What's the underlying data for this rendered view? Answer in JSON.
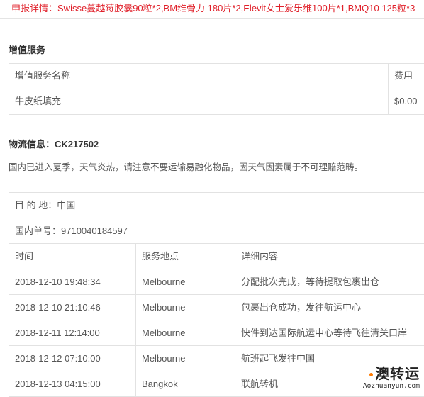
{
  "declaration": {
    "label": "申报详情：",
    "value": "Swisse蔓越莓胶囊90粒*2,BM维骨力 180片*2,Elevit女士爱乐维100片*1,BMQ10 125粒*3"
  },
  "value_added": {
    "title": "增值服务",
    "headers": {
      "name": "增值服务名称",
      "fee": "费用"
    },
    "rows": [
      {
        "name": "牛皮纸填充",
        "fee": "$0.00"
      }
    ]
  },
  "logistics": {
    "title": "物流信息：CK217502",
    "notice": "国内已进入夏季，天气炎热，请注意不要运输易融化物品，因天气因素属于不可理赔范畴。",
    "destination": "目 的 地：中国",
    "tracking": "国内单号：9710040184597",
    "headers": {
      "time": "时间",
      "place": "服务地点",
      "detail": "详细内容"
    },
    "rows": [
      {
        "time": "2018-12-10 19:48:34",
        "place": "Melbourne",
        "detail": "分配批次完成，等待提取包裹出仓"
      },
      {
        "time": "2018-12-10 21:10:46",
        "place": "Melbourne",
        "detail": "包裹出仓成功，发往航运中心"
      },
      {
        "time": "2018-12-11 12:14:00",
        "place": "Melbourne",
        "detail": "快件到达国际航运中心等待飞往清关口岸"
      },
      {
        "time": "2018-12-12 07:10:00",
        "place": "Melbourne",
        "detail": "航班起飞发往中国"
      },
      {
        "time": "2018-12-13 04:15:00",
        "place": "Bangkok",
        "detail": "联航转机"
      }
    ]
  },
  "watermark": {
    "logo": "澳转运",
    "url": "Aozhuanyun.com"
  },
  "colors": {
    "declaration_text": "#e0202a",
    "border": "#e2e2e2",
    "watermark_dot": "#ff7a00"
  }
}
